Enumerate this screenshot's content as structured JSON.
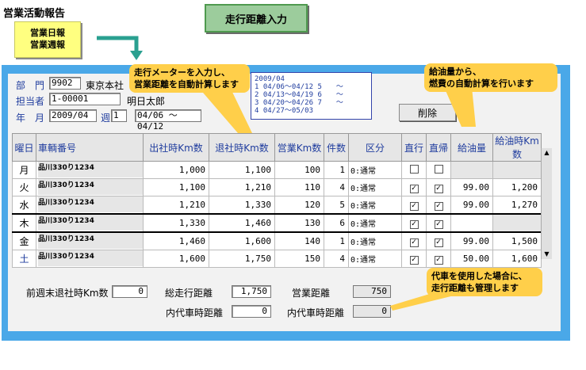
{
  "header": {
    "report_title": "営業活動報告",
    "nav_items": [
      "営業日報",
      "営業週報"
    ],
    "screen_title": "走行距離入力"
  },
  "form": {
    "dept_label": "部　門",
    "dept_code": "9902",
    "dept_name": "東京本社",
    "staff_label": "担当者",
    "staff_code": "1-00001",
    "staff_name": "明日太郎",
    "year_label": "年　月",
    "year_month": "2009/04",
    "week_label": "週",
    "week_no": "1",
    "date_range": "04/06 ～04/12",
    "delete_label": "削除"
  },
  "week_list": {
    "header": "2009/04",
    "items": [
      "1 04/06～04/12 5　　～",
      "2 04/13～04/19 6　　～",
      "3 04/20～04/26 7　　～",
      "4 04/27～05/03"
    ]
  },
  "table": {
    "columns": [
      "曜日",
      "車輌番号",
      "出社時Km数",
      "退社時Km数",
      "営業Km数",
      "件数",
      "区分",
      "直行",
      "直帰",
      "給油量",
      "給油時Km数"
    ],
    "rows": [
      {
        "day": "月",
        "car": "品川330り1234",
        "start": "1,000",
        "end": "1,100",
        "km": "100",
        "count": "1",
        "kubun": "0:通常",
        "direct": false,
        "return": false,
        "fuel": "",
        "fuel_km": ""
      },
      {
        "day": "火",
        "car": "品川330り1234",
        "start": "1,100",
        "end": "1,210",
        "km": "110",
        "count": "4",
        "kubun": "0:通常",
        "direct": true,
        "return": true,
        "fuel": "99.00",
        "fuel_km": "1,200"
      },
      {
        "day": "水",
        "car": "品川330り1234",
        "start": "1,210",
        "end": "1,330",
        "km": "120",
        "count": "5",
        "kubun": "0:通常",
        "direct": true,
        "return": true,
        "fuel": "99.00",
        "fuel_km": "1,270"
      },
      {
        "day": "木",
        "car": "品川330り1234",
        "start": "1,330",
        "end": "1,460",
        "km": "130",
        "count": "6",
        "kubun": "0:通常",
        "direct": true,
        "return": true,
        "fuel": "",
        "fuel_km": ""
      },
      {
        "day": "金",
        "car": "品川330り1234",
        "start": "1,460",
        "end": "1,600",
        "km": "140",
        "count": "1",
        "kubun": "0:通常",
        "direct": true,
        "return": true,
        "fuel": "99.00",
        "fuel_km": "1,500"
      },
      {
        "day": "土",
        "car": "品川330り1234",
        "start": "1,600",
        "end": "1,750",
        "km": "150",
        "count": "4",
        "kubun": "0:通常",
        "direct": true,
        "return": true,
        "fuel": "50.00",
        "fuel_km": "1,600"
      }
    ]
  },
  "footer": {
    "prev_label": "前週末退社時Km数",
    "prev_value": "0",
    "total_label": "総走行距離",
    "total_value": "1,750",
    "sales_label": "営業距離",
    "sales_value": "750",
    "sub1_label": "内代車時距離",
    "sub1_value": "0",
    "sub2_label": "内代車時距離",
    "sub2_value": "0"
  },
  "callouts": {
    "meter": [
      "走行メーターを入力し、",
      "営業距離を自動計算します"
    ],
    "fuel": [
      "給油量から、",
      "燃費の自動計算を行います"
    ],
    "substitute": [
      "代車を使用した場合に、",
      "走行距離も管理します"
    ]
  },
  "colors": {
    "window": "#4aa8e8",
    "title_bg": "#9ccc9c",
    "callout": "#ffcf4a",
    "nav_note": "#ffff80",
    "label": "#1f3c9e"
  }
}
